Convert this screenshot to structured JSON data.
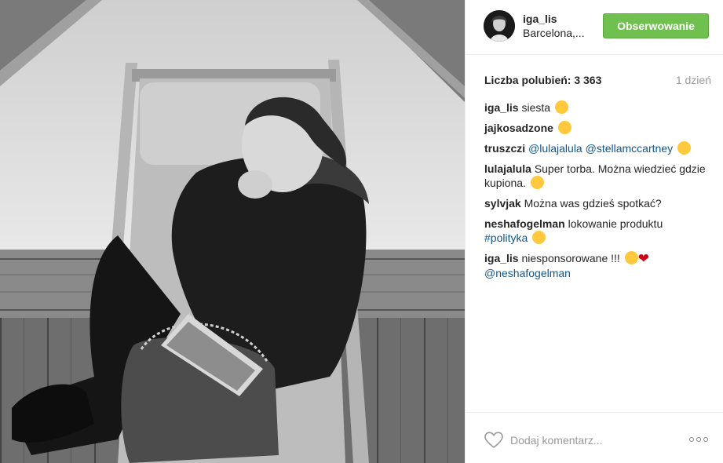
{
  "post": {
    "username": "iga_lis",
    "location": "Barcelona,...",
    "follow_label": "Obserwowanie",
    "likes": "Liczba polubień: 3 363",
    "time_ago": "1 dzień"
  },
  "comments": [
    {
      "user": "iga_lis",
      "parts": [
        {
          "t": "siesta"
        }
      ],
      "emoji": "sleepy-emoji"
    },
    {
      "user": "jajkosadzone",
      "parts": [],
      "emoji": "heart-eyes-emoji"
    },
    {
      "user": "truszczi",
      "parts": [
        {
          "t": "@lulajalula",
          "tag": true
        },
        {
          "t": "@stellamccartney",
          "tag": true
        }
      ],
      "emoji": "wink-emoji"
    },
    {
      "user": "lulajalula",
      "parts": [
        {
          "t": "Super torba. Można wiedzieć gdzie kupiona."
        }
      ],
      "emoji": "grin-emoji"
    },
    {
      "user": "sylvjak",
      "parts": [
        {
          "t": "Można was gdzieś spotkać?"
        }
      ],
      "emoji": ""
    },
    {
      "user": "neshafogelman",
      "parts": [
        {
          "t": "lokowanie produktu"
        },
        {
          "t": "#polityka",
          "tag": true
        }
      ],
      "emoji": "heart-eyes-emoji"
    },
    {
      "user": "iga_lis",
      "parts": [
        {
          "t": "niesponsorowane !!!"
        }
      ],
      "emoji": "laugh-emoji",
      "heart": true,
      "tail": [
        {
          "t": "@neshafogelman",
          "tag": true
        }
      ]
    }
  ],
  "footer": {
    "comment_placeholder": "Dodaj komentarz..."
  },
  "icons": {
    "like": "heart-outline-icon",
    "more": "more-options-icon"
  },
  "colors": {
    "follow_button": "#70c050",
    "link": "#125688",
    "muted": "#999999"
  }
}
